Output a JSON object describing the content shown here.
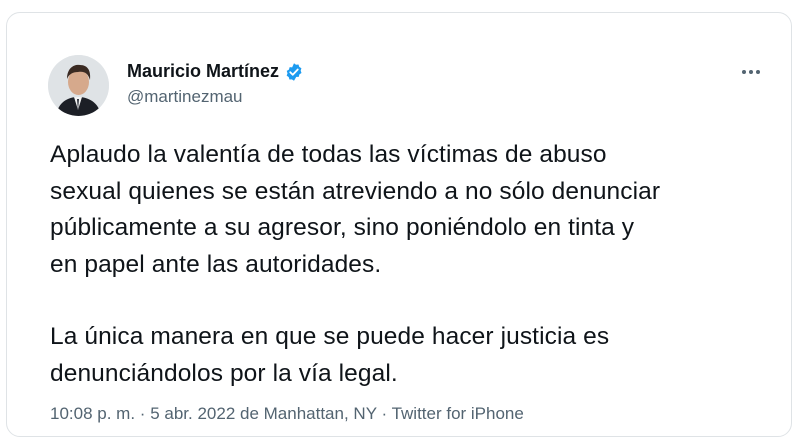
{
  "tweet": {
    "author_name": "Mauricio Martínez",
    "handle": "@martinezmau",
    "verified": true,
    "paragraphs": [
      "Aplaudo la valentía de todas las víctimas de abuso\nsexual quienes se están atreviendo a no sólo denunciar\npúblicamente a su agresor, sino poniéndolo en tinta y\nen papel ante las autoridades.",
      "La única manera en que se puede hacer justicia es\ndenunciándolos por la vía legal."
    ],
    "time": "10:08 p. m.",
    "separator": "·",
    "date_location": "5 abr. 2022 de Manhattan, NY",
    "source": "Twitter for iPhone"
  },
  "colors": {
    "text": "#0f1419",
    "secondary": "#536471",
    "verified_blue": "#1d9bf0",
    "border": "#dfe3e6"
  },
  "icons": {
    "verified": "verified-badge-icon",
    "more": "more-dots-icon"
  }
}
